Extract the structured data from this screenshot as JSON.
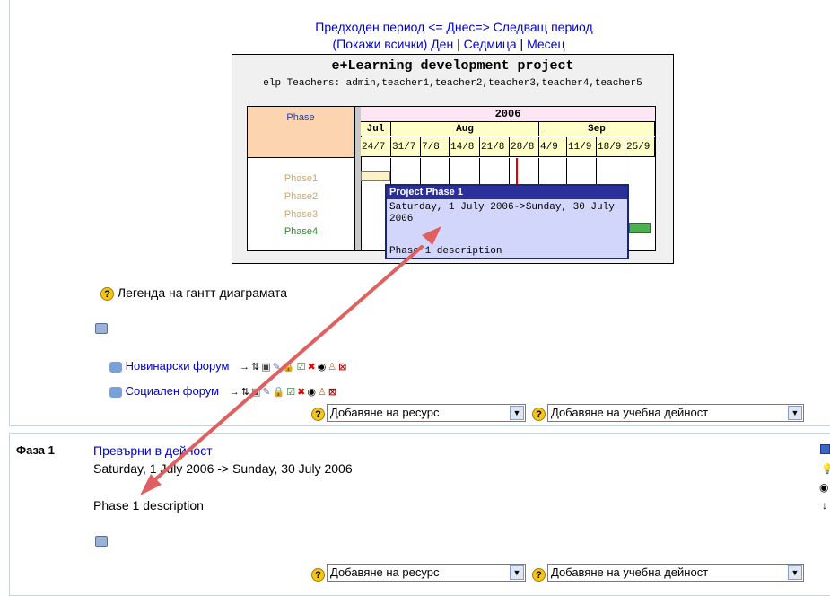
{
  "nav": {
    "prev_period": "Предходен период",
    "today": "<= Днес=>",
    "next_period": "Следващ период",
    "show_all": "(Покажи всички)",
    "day": "Ден",
    "sep1": "|",
    "week": "Седмица",
    "sep2": "|",
    "month": "Месец"
  },
  "gantt": {
    "title": "e+Learning development project",
    "teachers_line": "elp  Teachers: admin,teacher1,teacher2,teacher3,teacher4,teacher5",
    "phase_header": "Phase",
    "year": "2006",
    "months": [
      "Jul",
      "Aug",
      "Sep"
    ],
    "weeks": [
      "24/7",
      "31/7",
      "7/8",
      "14/8",
      "21/8",
      "28/8",
      "4/9",
      "11/9",
      "18/9",
      "25/9"
    ],
    "phases": [
      {
        "label": "Phase1",
        "color": "#c8a870"
      },
      {
        "label": "Phase2",
        "color": "#c8a870"
      },
      {
        "label": "Phase3",
        "color": "#c8a870"
      },
      {
        "label": "Phase4",
        "color": "#2e8b2e"
      }
    ],
    "today_line_color": "#dd0000",
    "tooltip": {
      "title": "Project Phase 1",
      "dates": "Saturday, 1 July 2006->Sunday, 30 July 2006",
      "description": "Phase 1 description"
    }
  },
  "legend_label": "Легенда на гантт диаграмата",
  "forums": [
    {
      "label": "Новинарски форум"
    },
    {
      "label": "Социален форум"
    }
  ],
  "add_resource": "Добавяне на ресурс",
  "add_activity": "Добавяне на учебна дейност",
  "phase_section": {
    "phase_name": "Фаза 1",
    "convert_link": "Превърни в дейност",
    "dates": "Saturday, 1 July 2006 -> Sunday, 30 July 2006",
    "description": "Phase 1 description"
  },
  "colors": {
    "arrow": "#e06060",
    "link": "#0000cc",
    "tooltip_header": "#2b2f9a",
    "tooltip_bg": "#d3d6fb"
  }
}
